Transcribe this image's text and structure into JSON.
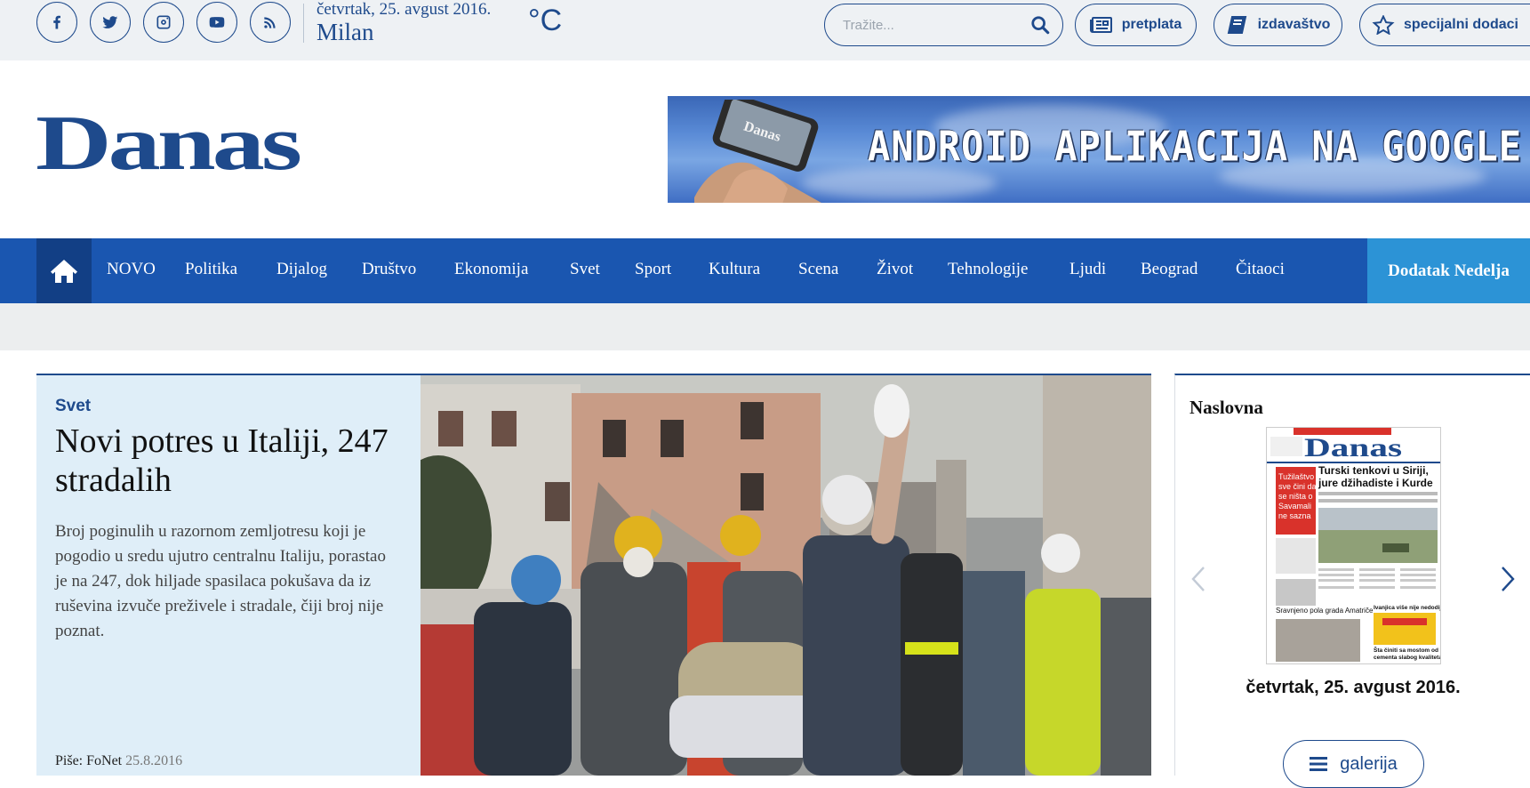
{
  "topbar": {
    "social": [
      {
        "name": "facebook-icon",
        "glyph": "f"
      },
      {
        "name": "twitter-icon"
      },
      {
        "name": "instagram-icon"
      },
      {
        "name": "youtube-icon"
      },
      {
        "name": "rss-icon"
      }
    ],
    "date": "četvrtak, 25. avgust 2016.",
    "city": "Milan",
    "temp_unit": "°C",
    "search_placeholder": "Tražite...",
    "buttons": {
      "subscription": "pretplata",
      "publishing": "izdavaštvo",
      "specials": "specijalni dodaci"
    }
  },
  "header": {
    "logo_text": "Danas",
    "banner_text": "ANDROID APLIKACIJA NA GOOGLE PLAY",
    "banner_phone_brand": "Danas"
  },
  "nav": {
    "items": [
      "NOVO",
      "Politika",
      "Dijalog",
      "Društvo",
      "Ekonomija",
      "Svet",
      "Sport",
      "Kultura",
      "Scena",
      "Život",
      "Tehnologije",
      "Ljudi",
      "Beograd",
      "Čitaoci"
    ],
    "extra": "Dodatak Nedelja"
  },
  "feature": {
    "kicker": "Svet",
    "headline": "Novi potres u Italiji, 247 stradalih",
    "lead": "Broj poginulih u razornom zemljotresu koji je pogodio u sredu ujutro centralnu Italiju, porastao je na 247, dok hiljade spasilaca pokušava da iz ruševina izvuče preživele i stradale, čiji broj nije poznat.",
    "author_prefix": "Piše:",
    "author": "FoNet",
    "date": "25.8.2016"
  },
  "sidebar": {
    "title": "Naslovna",
    "cover": {
      "masthead": "Danas",
      "headline": "Turski tenkovi u Siriji, jure džihadiste i Kurde",
      "red_box": "Tužilaštvo sve čini da se ništa o Savamali ne sazna",
      "side_headline": "Šta činiti sa mostom od cementa slabog kvaliteta?",
      "box_label": "Ivanjica više nije nedodija",
      "bottom": "Sravnjeno pola grada Amatriče"
    },
    "date": "četvrtak, 25. avgust 2016.",
    "gallery_label": "galerija"
  },
  "colors": {
    "brand": "#1e4a8c",
    "nav": "#1a56b0",
    "nav_extra": "#2c93d6",
    "feature_bg": "#dfeef8"
  }
}
